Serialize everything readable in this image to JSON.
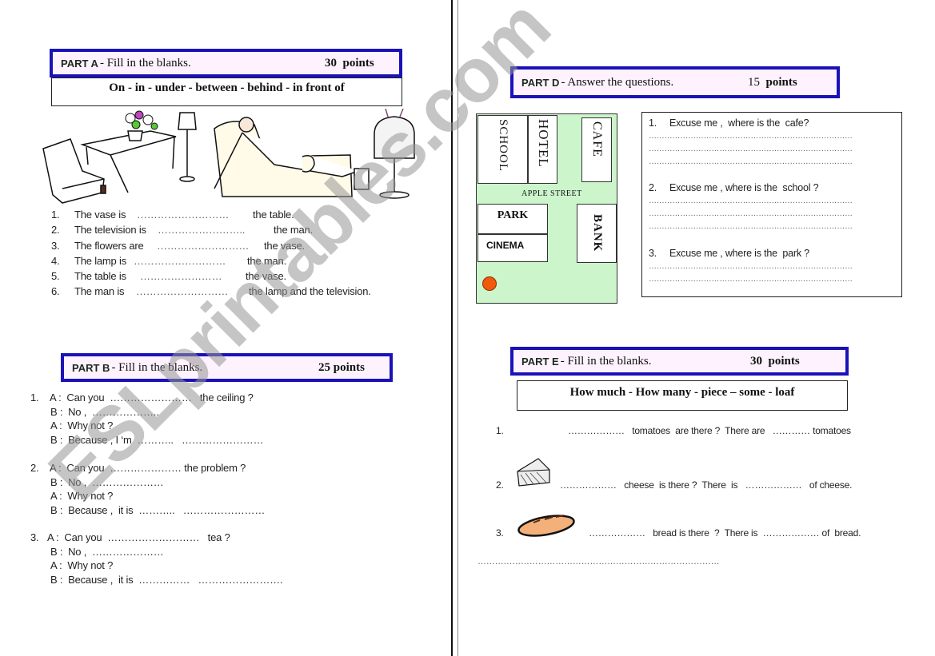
{
  "part_a": {
    "tag": "PART A",
    "instruction": "- Fill in the blanks.",
    "points_num": "30",
    "points_label": "points",
    "word_bank": "On  -  in  -  under  -  between  -  behind  -  in front of",
    "items": [
      {
        "num": "1.",
        "before": "The vase is",
        "blank": "………………………",
        "after": "the table."
      },
      {
        "num": "2.",
        "before": "The television is",
        "blank": "……………………..",
        "after": "the man."
      },
      {
        "num": "3.",
        "before": "The flowers are",
        "blank": "………………………",
        "after": "the vase."
      },
      {
        "num": "4.",
        "before": "The lamp is",
        "blank": "………………………",
        "after": "the man."
      },
      {
        "num": "5.",
        "before": "The table is",
        "blank": "……………………",
        "after": "the vase."
      },
      {
        "num": "6.",
        "before": "The man is",
        "blank": "………………………",
        "after": "the lamp and the television."
      }
    ]
  },
  "part_b": {
    "tag": "PART B",
    "instruction": "- Fill in the blanks.",
    "points_num": "25",
    "points_label": "points",
    "dialogs": [
      {
        "num": "1.",
        "lines": [
          "A :  Can you  ……………………   the ceiling ?",
          "B :  No ,  ………………..",
          "A :  Why not ?",
          "B :  Because , I ‘m  ………..   ……………………"
        ]
      },
      {
        "num": "2.",
        "lines": [
          "A :  Can you  ………………… the problem ?",
          "B :  No ,  …………………",
          "A :  Why not ?",
          "B :  Because ,  it is  ………..   ……………………"
        ]
      },
      {
        "num": "3.",
        "lines": [
          "A :  Can you  ………………………   tea ?",
          "B :  No ,  …………………",
          "A :  Why not ?",
          "B :  Because ,  it is  ……………   ……………………."
        ]
      }
    ]
  },
  "part_d": {
    "tag": "PART D",
    "instruction": "-   Answer the questions.",
    "points_num": "15",
    "points_label": "points",
    "map": {
      "buildings": [
        "SCHOOL",
        "HOTEL",
        "CAFE",
        "PARK",
        "CINEMA",
        "BANK"
      ],
      "street": "APPLE     STREET",
      "marker_color": "#f05a0a"
    },
    "questions": [
      {
        "num": "1.",
        "text": "Excuse me ,  where is the  cafe?",
        "answer_lines": 3
      },
      {
        "num": "2.",
        "text": "Excuse me , where is the  school ?",
        "answer_lines": 3
      },
      {
        "num": "3.",
        "text": "Excuse me , where is the  park ?",
        "answer_lines": 2
      }
    ],
    "answer_line": "……………………………………………………………………"
  },
  "part_e": {
    "tag": "PART E",
    "instruction": "-  Fill  in the blanks.",
    "points_num": "30",
    "points_label": "points",
    "word_bank": "How much -  How many -  piece – some - loaf",
    "items": [
      {
        "num": "1.",
        "icon": "tomato",
        "text": "………………   tomatoes  are there ?  There are   ………… tomatoes"
      },
      {
        "num": "2.",
        "icon": "cheese",
        "text": "………………   cheese  is there ?  There  is   ………………   of cheese."
      },
      {
        "num": "3.",
        "icon": "bread",
        "text": "………………   bread is there  ?  There is  ……………… of  bread."
      }
    ],
    "extra_line": "…………………………………………………………………………"
  },
  "watermark": "ESLprintables.com",
  "colors": {
    "header_border": "#1a12b8",
    "header_fill": "#fdf2fd",
    "map_green": "#ccf5cc"
  }
}
